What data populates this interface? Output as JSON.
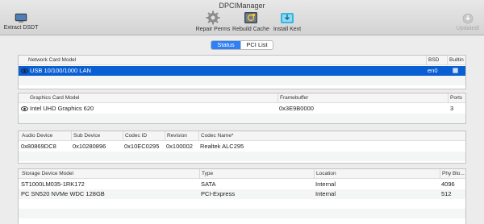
{
  "window": {
    "title": "DPCIManager"
  },
  "toolbar": {
    "extract": "Extract DSDT",
    "repair": "Repair Perms",
    "rebuild": "Rebuild Cache",
    "install": "Install Kext",
    "updated": "Updated!"
  },
  "tabs": {
    "status": "Status",
    "pci_list": "PCI List",
    "selected": "Status"
  },
  "network": {
    "headers": [
      "Network Card Model",
      "BSD",
      "Builtin"
    ],
    "rows": [
      {
        "model": "USB 10/100/1000 LAN",
        "bsd": "en0",
        "builtin": true
      }
    ]
  },
  "graphics": {
    "headers": [
      "Graphics Card Model",
      "Framebuffer",
      "Ports"
    ],
    "rows": [
      {
        "model": "Intel UHD Graphics 620",
        "framebuffer": "0x3E9B0000",
        "ports": "3"
      }
    ]
  },
  "audio": {
    "headers": [
      "Audio Device",
      "Sub Device",
      "Codec ID",
      "Revision",
      "Codec Name*"
    ],
    "rows": [
      {
        "device": "0x80869DC8",
        "sub": "0x10280896",
        "codec_id": "0x10EC0295",
        "revision": "0x100002",
        "name": "Realtek ALC295"
      }
    ]
  },
  "storage": {
    "headers": [
      "Storage Device Model",
      "Type",
      "Location",
      "Phy Blo..."
    ],
    "rows": [
      {
        "model": "ST1000LM035-1RK172",
        "type": "SATA",
        "location": "Internal",
        "blocks": "4096"
      },
      {
        "model": "PC SN520 NVMe WDC 128GB",
        "type": "PCI-Express",
        "location": "Internal",
        "blocks": "512"
      }
    ]
  },
  "colors": {
    "selection": "#0a5fd3",
    "segment_active": "#2f7ff5"
  }
}
